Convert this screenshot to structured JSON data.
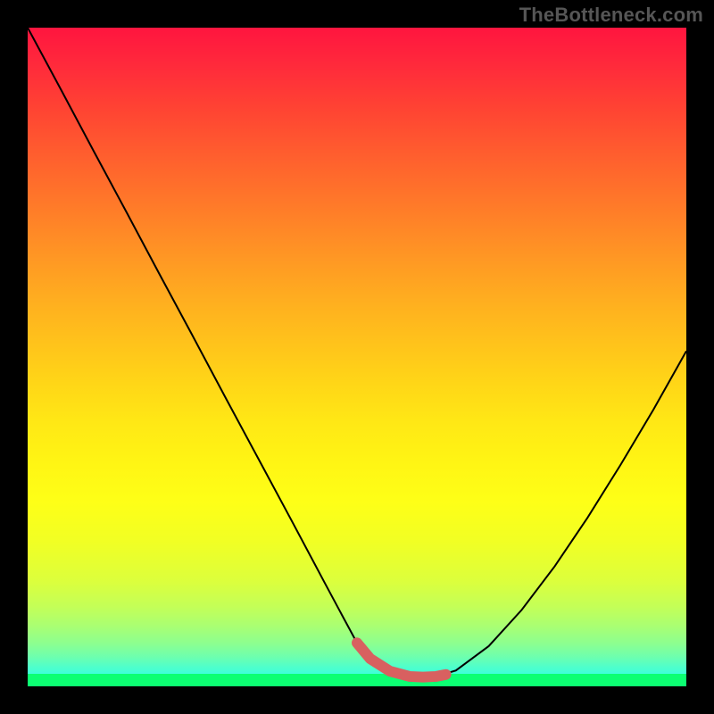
{
  "watermark": "TheBottleneck.com",
  "colors": {
    "page_bg": "#000000",
    "watermark_text": "#565656",
    "curve_stroke": "#000000",
    "thick_seg_stroke": "#d86060",
    "green_band": "#0cff72"
  },
  "chart_data": {
    "type": "line",
    "title": "",
    "xlabel": "",
    "ylabel": "",
    "xlim": [
      0,
      100
    ],
    "ylim": [
      0,
      100
    ],
    "grid": false,
    "background": "rainbow-gradient (red top to green bottom)",
    "series": [
      {
        "name": "bottleneck-curve",
        "stroke": "#000000",
        "x": [
          0,
          5,
          10,
          15,
          20,
          25,
          30,
          35,
          40,
          45,
          48,
          50,
          52,
          55,
          58,
          60,
          62,
          65,
          70,
          75,
          80,
          85,
          90,
          95,
          100
        ],
        "y": [
          100,
          90.7,
          81.3,
          72.0,
          62.6,
          53.3,
          43.9,
          34.6,
          25.3,
          15.9,
          10.3,
          6.6,
          4.2,
          2.3,
          1.5,
          1.4,
          1.5,
          2.4,
          6.1,
          11.6,
          18.2,
          25.6,
          33.6,
          42.0,
          50.9
        ]
      }
    ],
    "highlight_segment": {
      "name": "flat-minimum",
      "stroke": "#d86060",
      "stroke_width": 12,
      "x": [
        50,
        52,
        55,
        58,
        60,
        62,
        63.5
      ],
      "y": [
        6.6,
        4.2,
        2.3,
        1.5,
        1.4,
        1.5,
        1.8
      ]
    }
  }
}
